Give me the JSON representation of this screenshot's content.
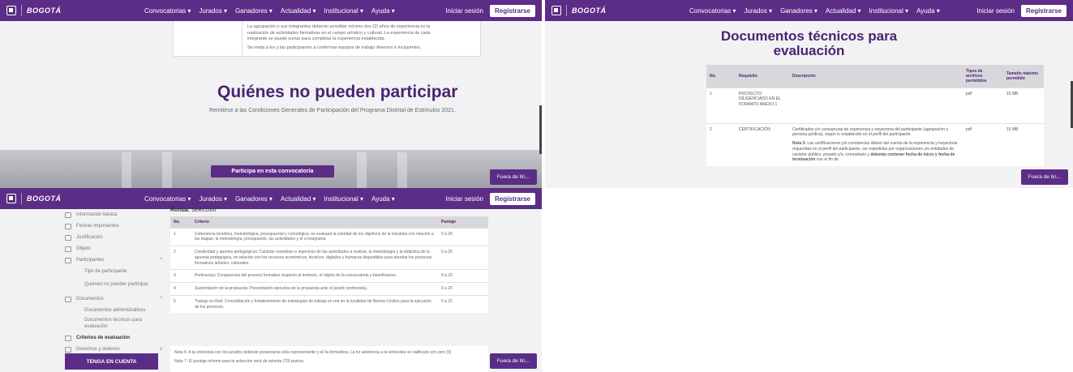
{
  "nav": {
    "brand": "BOGOTÁ",
    "menu": [
      "Convocatorias ▾",
      "Jurados ▾",
      "Ganadores ▾",
      "Actualidad ▾",
      "Institucional ▾",
      "Ayuda ▾"
    ],
    "login": "Iniciar sesión",
    "register": "Registrarse"
  },
  "fuera_label": "Fuera de lín...",
  "panel1": {
    "box_text": [
      "La agrupación o sus integrantes deberán acreditar mínimo dos (2) años de experiencia en la",
      "realización de actividades formativas en el campo artístico y cultural. La experiencia de cada",
      "integrante se puede sumar para completar la experiencia establecida.",
      "Se invita a los y las participantes a conformar equipos de trabajo diversos e incluyentes."
    ],
    "title": "Quiénes no pueden participar",
    "subtitle": "Remitirse a las Condiciones Generales de Participación del Programa Distrital de Estímulos 2021.",
    "cta": "Participa en esta convocatoria"
  },
  "panel2": {
    "title_line1": "Documentos técnicos para",
    "title_line2": "evaluación",
    "headers": [
      "No.",
      "Requisito",
      "Descripción",
      "Tipos de archivos permitidos",
      "Tamaño máximo permitido"
    ],
    "rows": [
      {
        "no": "1",
        "req": "PROYECTO DILIGENCIADO EN EL FORMATO ANEXO 1",
        "desc": "",
        "tipo": "pdf",
        "tam": "15 MB"
      },
      {
        "no": "2",
        "req": "CERTIFICACIÓN",
        "desc": "Certificados y/o constancias de experiencia y trayectoria del participante (agrupación o persona jurídica), según lo establecido en el perfil del participante.",
        "note_label": "Nota 3:",
        "note": "Las certificaciones y/o constancias deben dar cuenta de la experiencia y trayectoria requeridas en el perfil del participante, ser expedidas por organizaciones y/o entidades de carácter público, privado y/o, comunitario y",
        "note_bold": "deberán contener fecha de inicio y fecha de terminación",
        "note_tail": "con el fin de",
        "tipo": "pdf",
        "tam": "15 MB"
      }
    ]
  },
  "panel3": {
    "sidebar": [
      {
        "label": "Información básica",
        "icon": "info-icon"
      },
      {
        "label": "Fechas importantes",
        "icon": "calendar-icon"
      },
      {
        "label": "Justificación",
        "icon": "document-icon"
      },
      {
        "label": "Objeto",
        "icon": "target-icon"
      },
      {
        "label": "Participantes",
        "icon": "people-icon",
        "chevron": "^"
      }
    ],
    "sub_participantes": [
      "Tipo de participante",
      "Quiénes no pueden participar"
    ],
    "documentos": {
      "label": "Documentos",
      "chevron": "^"
    },
    "sub_documentos": [
      "Documentos administrativos",
      "Documentos técnicos para evaluación"
    ],
    "criterios": "Criterios de evaluación",
    "derechos": {
      "label": "Derechos y deberes",
      "chevron": "v"
    },
    "tenga": "TENGA EN CUENTA",
    "ronda_label": "Ronda:",
    "ronda_value": "Selección",
    "headers": [
      "No.",
      "Criterio",
      "Puntaje"
    ],
    "rows": [
      {
        "no": "1",
        "crit": "Coherencia temática, metodológica, presupuestal y cronológica: se evaluará la claridad de los objetivos de la iniciativa con relación a las etapas, la metodología, presupuesto, las actividades y el cronograma",
        "pts": "0 a 20"
      },
      {
        "no": "2",
        "crit": "Creatividad y aportes pedagógicos: Carácter novedoso e ingenioso de las actividades a realizar, la metodología y la didáctica de la apuesta pedagógica, en relación con los recursos económicos, técnicos, digitales y humanos disponibles para abordar los procesos formativos artístico- culturales.",
        "pts": "0 a 25"
      },
      {
        "no": "3",
        "crit": "Pertinencia: Congruencia del proceso formativo respecto al territorio, el objeto de la convocatoria y beneficiarios.",
        "pts": "0 a 20"
      },
      {
        "no": "4",
        "crit": "Sustentación de la propuesta: Presentación ejecutiva de la propuesta ante el jurado (entrevista).",
        "pts": "0 a 20"
      },
      {
        "no": "5",
        "crit": "Trabajo en Red: Consolidación y fortalecimiento de estrategias de trabajo en red en la localidad de Barrios Unidos para la ejecución de los procesos.",
        "pts": "0 a 15"
      }
    ],
    "note6": "Nota 6: A la entrevista con los jurados deberán presentarse el/la representante y el/ la formadora. La no asistencia a la entrevista se calificará con cero (0)",
    "note7": "Nota 7: El puntaje mínimo para la selección será de setenta (70) puntos."
  }
}
